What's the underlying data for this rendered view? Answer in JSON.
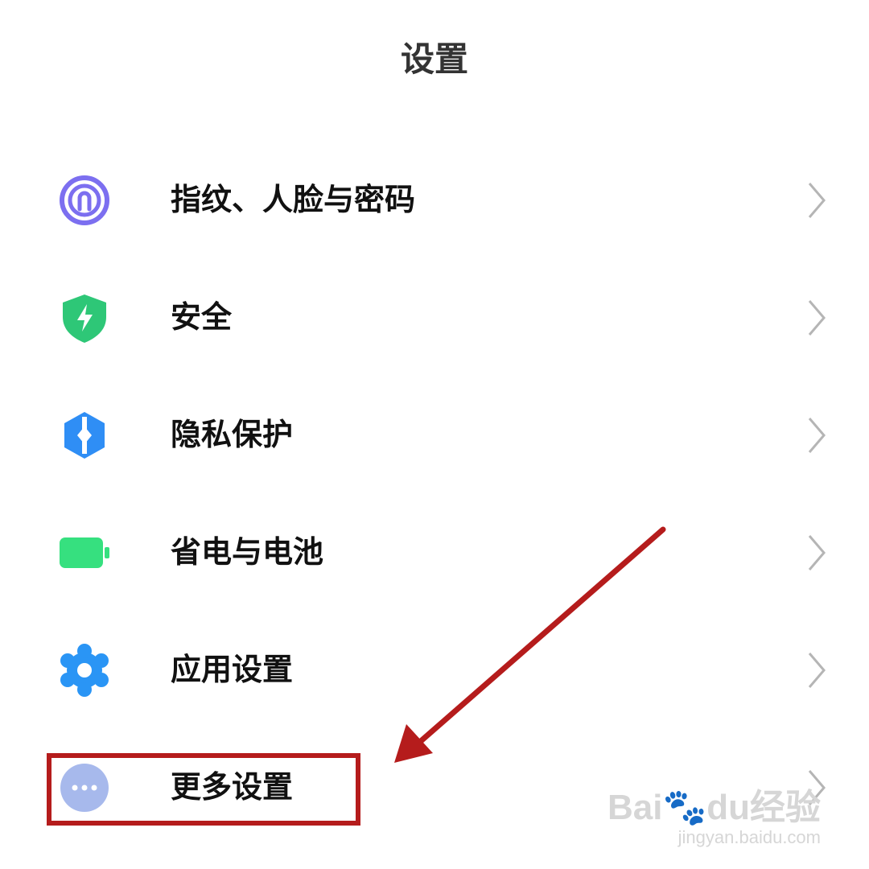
{
  "header": {
    "title": "设置"
  },
  "settings": [
    {
      "label": "指纹、人脸与密码",
      "icon": "fingerprint-icon",
      "color": "#7c6ff0"
    },
    {
      "label": "安全",
      "icon": "security-shield-icon",
      "color": "#2ec777"
    },
    {
      "label": "隐私保护",
      "icon": "privacy-icon",
      "color": "#2f8ef5"
    },
    {
      "label": "省电与电池",
      "icon": "battery-icon",
      "color": "#36e07f"
    },
    {
      "label": "应用设置",
      "icon": "gear-icon",
      "color": "#2a95f5"
    },
    {
      "label": "更多设置",
      "icon": "more-dots-icon",
      "color": "#a7b9ec"
    }
  ],
  "annotation": {
    "color": "#b51c1c"
  },
  "watermark": {
    "brand": "Bai",
    "brand2": "du",
    "cn": "经验",
    "url": "jingyan.baidu.com"
  }
}
